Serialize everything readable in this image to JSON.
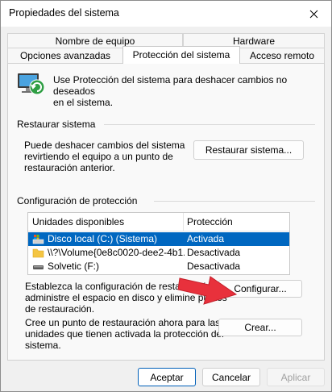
{
  "window": {
    "title": "Propiedades del sistema"
  },
  "tabs": {
    "row1": [
      "Nombre de equipo",
      "Hardware"
    ],
    "row2": [
      "Opciones avanzadas",
      "Protección del sistema",
      "Acceso remoto"
    ],
    "active": "Protección del sistema"
  },
  "intro": {
    "text_line1": "Use Protección del sistema para deshacer cambios no deseados",
    "text_line2": "en el sistema."
  },
  "restore": {
    "group_title": "Restaurar sistema",
    "desc_line1": "Puede deshacer cambios del sistema",
    "desc_line2": "revirtiendo el equipo a un punto de",
    "desc_line3": "restauración anterior.",
    "button_label": "Restaurar sistema..."
  },
  "protection": {
    "group_title": "Configuración de protección",
    "columns": [
      "Unidades disponibles",
      "Protección"
    ],
    "rows": [
      {
        "drive": "Disco local (C:) (Sistema)",
        "status": "Activada",
        "icon": "system-drive-icon"
      },
      {
        "drive": "\\\\?\\Volume{0e8c0020-dee2-4b1...",
        "status": "Desactivada",
        "icon": "folder-icon"
      },
      {
        "drive": "Solvetic (F:)",
        "status": "Desactivada",
        "icon": "drive-icon"
      }
    ],
    "config_line1": "Establezca la configuración de restauración,",
    "config_line2": "administre el espacio en disco y elimine puntos",
    "config_line3": "de restauración.",
    "config_button": "Configurar...",
    "create_line1": "Cree un punto de restauración ahora para las",
    "create_line2": "unidades que tienen activada la protección del",
    "create_line3": "sistema.",
    "create_button": "Crear..."
  },
  "footer": {
    "accept": "Aceptar",
    "cancel": "Cancelar",
    "apply": "Aplicar"
  },
  "colors": {
    "selection": "#0067c0",
    "arrow": "#e8313c",
    "accent": "#005fb8"
  }
}
